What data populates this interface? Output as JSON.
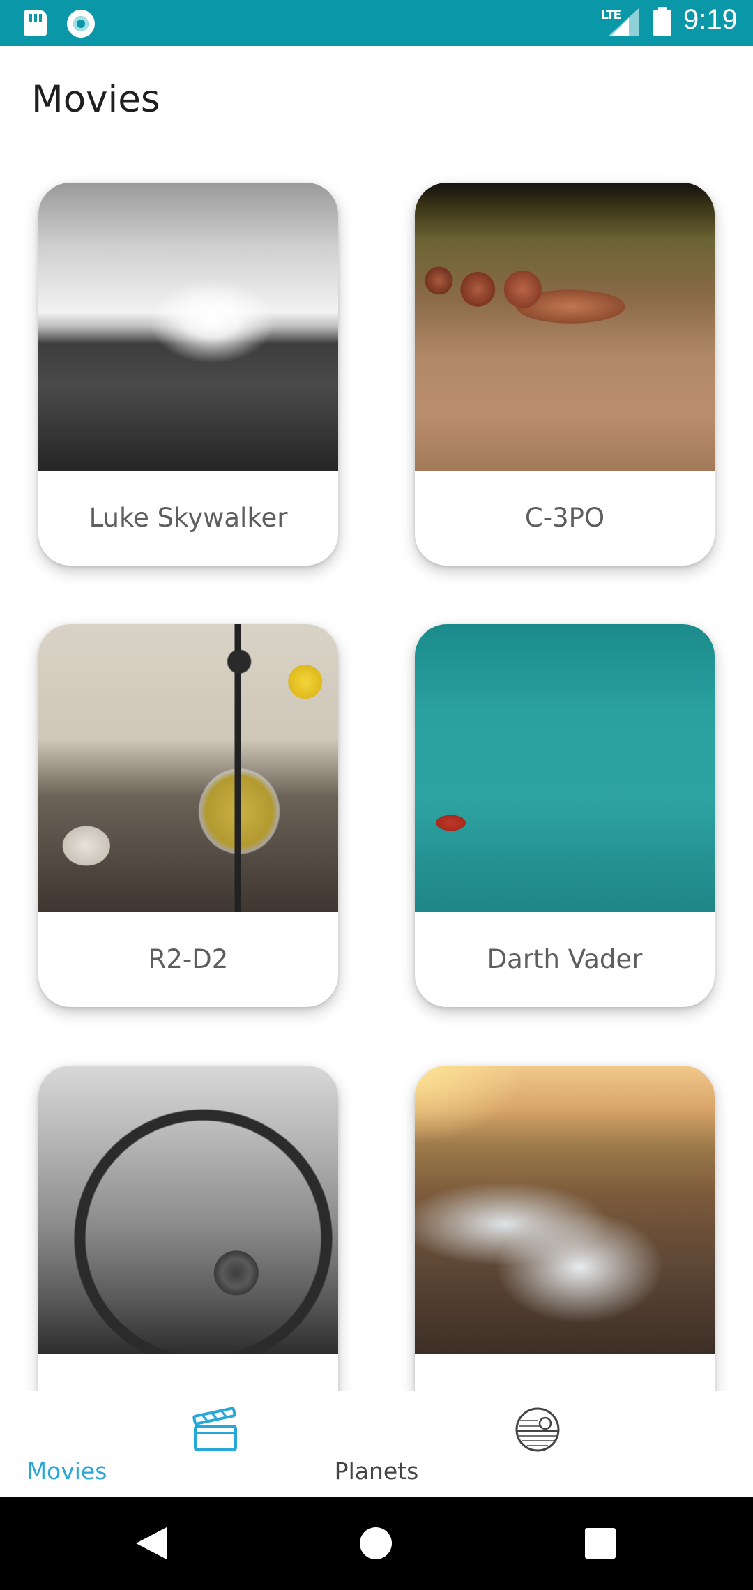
{
  "status_bar": {
    "time": "9:19",
    "network": "LTE",
    "icons": [
      "sd-card-icon",
      "sync-ring-icon",
      "signal-icon",
      "battery-icon"
    ]
  },
  "page": {
    "title": "Movies"
  },
  "cards": [
    {
      "label": "Luke Skywalker",
      "image": "black-and-white-field-sunset-photo"
    },
    {
      "label": "C-3PO",
      "image": "seed-pods-on-wood-photo"
    },
    {
      "label": "R2-D2",
      "image": "glass-teapot-photo"
    },
    {
      "label": "Darth Vader",
      "image": "boat-on-turquoise-water-photo"
    },
    {
      "label": "",
      "image": "wagon-wheel-black-and-white-photo"
    },
    {
      "label": "",
      "image": "snowy-path-sunset-photo"
    }
  ],
  "bottom_nav": {
    "items": [
      {
        "label": "Movies",
        "icon": "clapperboard-icon",
        "active": true
      },
      {
        "label": "Planets",
        "icon": "death-star-icon",
        "active": false
      }
    ],
    "active_color": "#27a8d8",
    "inactive_color": "#444444"
  },
  "colors": {
    "status_bar": "#0a97a8",
    "background": "#ffffff",
    "card_label": "#5e5e5e"
  }
}
